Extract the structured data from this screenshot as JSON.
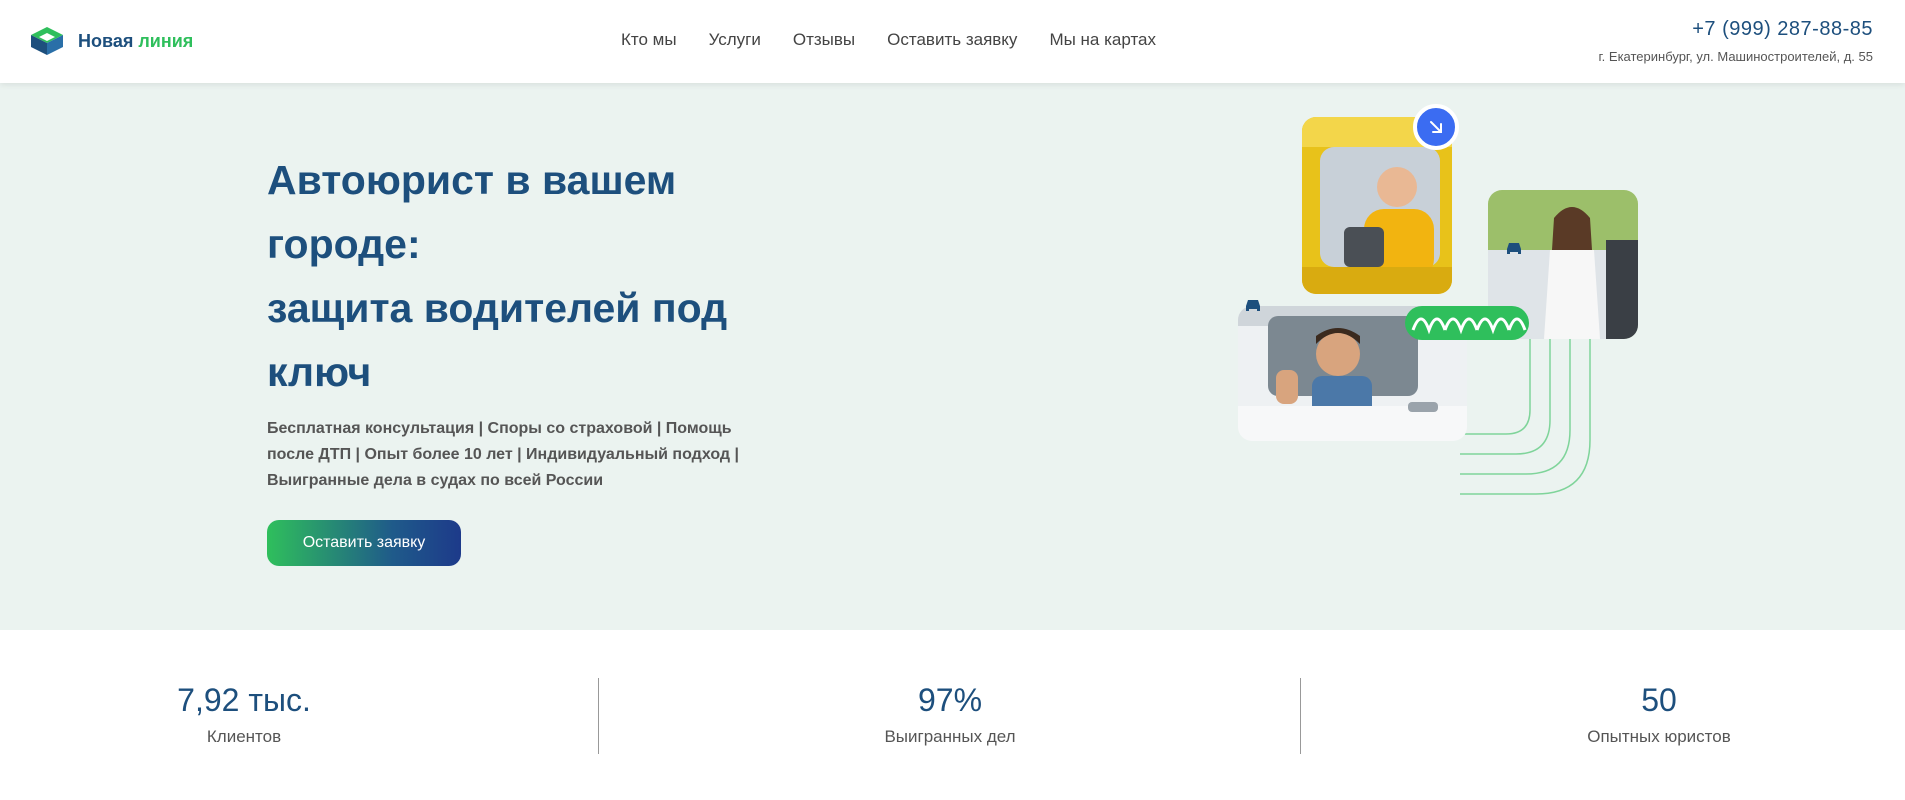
{
  "header": {
    "logo_part1": "Новая",
    "logo_part2": "линия",
    "nav": [
      "Кто мы",
      "Услуги",
      "Отзывы",
      "Оставить заявку",
      "Мы на картах"
    ],
    "phone": "+7 (999) 287-88-85",
    "address": "г. Екатеринбург, ул. Машиностроителей, д. 55"
  },
  "hero": {
    "title_line1": "Автоюрист в вашем",
    "title_line2": "городе:",
    "title_line3": "защита водителей под",
    "title_line4": "ключ",
    "subtitle": "Бесплатная консультация | Споры со страховой | Помощь после ДТП | Опыт более 10 лет | Индивидуальный подход | Выигранные дела в судах по всей России",
    "cta_label": "Оставить заявку"
  },
  "stats": [
    {
      "value": "7,92 тыс.",
      "label": "Клиентов"
    },
    {
      "value": "97%",
      "label": "Выигранных дел"
    },
    {
      "value": "50",
      "label": "Опытных юристов"
    }
  ],
  "colors": {
    "brand_blue": "#1d4f7d",
    "brand_green": "#2fbf5c",
    "hero_bg": "#ebf3f0",
    "badge_blue": "#3b6cf2"
  },
  "icons": [
    "logo-cube-icon",
    "arrow-down-right-icon",
    "car-icon"
  ]
}
